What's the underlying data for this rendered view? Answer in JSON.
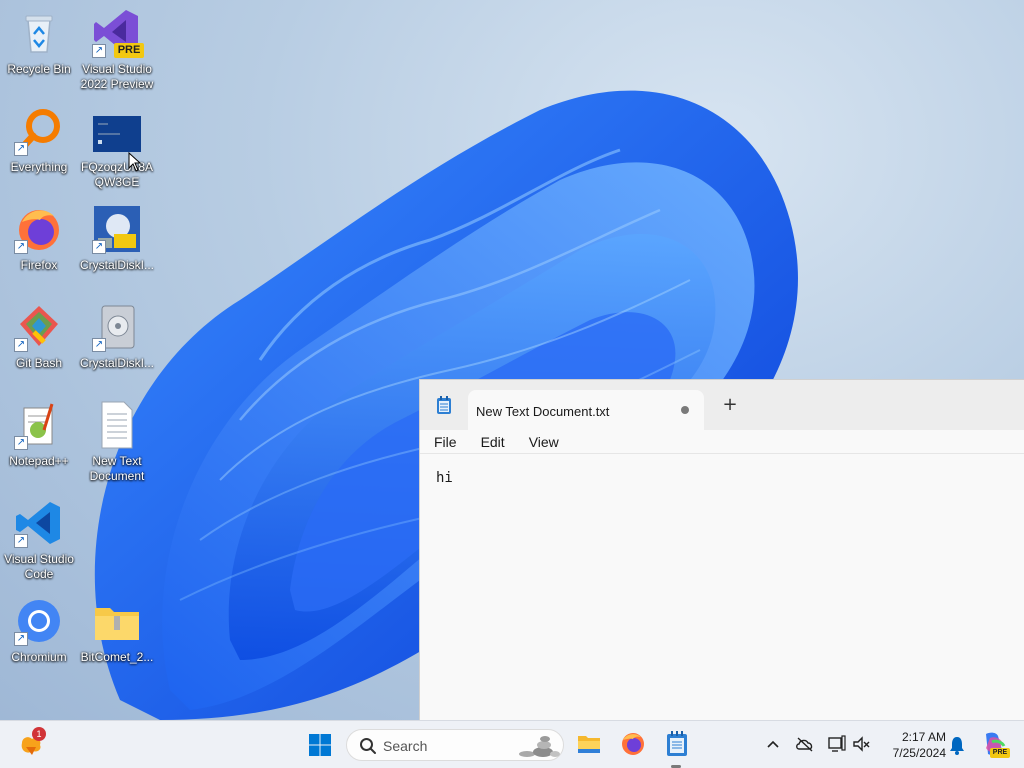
{
  "desktop": {
    "icons": [
      {
        "label": "Recycle Bin",
        "icon": "recycle-bin-icon"
      },
      {
        "label": "Visual Studio 2022 Preview",
        "icon": "visual-studio-icon",
        "badge": "PRE"
      },
      {
        "label": "Everything",
        "icon": "everything-search-icon"
      },
      {
        "label": "FQzoqzUh8A QW3GE",
        "icon": "dark-window-file-icon"
      },
      {
        "label": "Firefox",
        "icon": "firefox-icon"
      },
      {
        "label": "CrystalDiskI...",
        "icon": "crystaldiskinfo-icon"
      },
      {
        "label": "Git Bash",
        "icon": "git-bash-icon"
      },
      {
        "label": "CrystalDiskI...",
        "icon": "crystaldiskmark-icon"
      },
      {
        "label": "Notepad++",
        "icon": "notepad-plus-plus-icon"
      },
      {
        "label": "New Text Document",
        "icon": "text-document-icon"
      },
      {
        "label": "Visual Studio Code",
        "icon": "vscode-icon"
      },
      {
        "label": "Chromium",
        "icon": "chromium-icon"
      },
      {
        "label": "BitComet_2...",
        "icon": "zip-folder-icon"
      }
    ]
  },
  "notepad": {
    "tab_title": "New Text Document.txt",
    "new_tab": "+",
    "menu": {
      "file": "File",
      "edit": "Edit",
      "view": "View"
    },
    "content": "hi"
  },
  "taskbar": {
    "search_placeholder": "Search",
    "widget_badge": "1",
    "time": "2:17 AM",
    "date": "7/25/2024",
    "copilot_badge": "PRE",
    "accent": "#0067c0"
  }
}
